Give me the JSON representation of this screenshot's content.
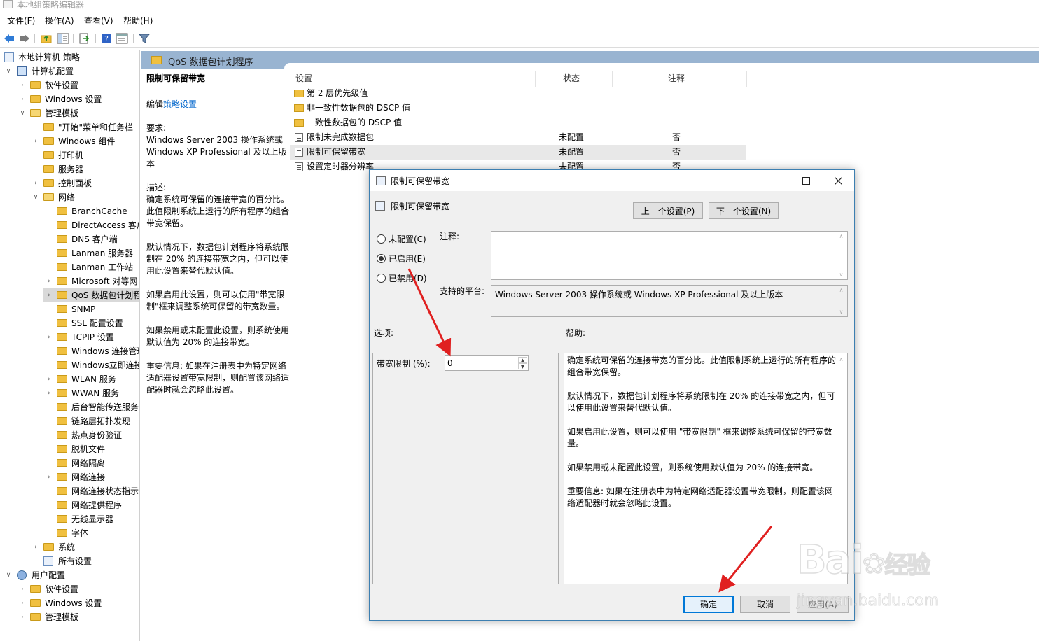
{
  "window": {
    "title": "本地组策略编辑器"
  },
  "menu": [
    "文件(F)",
    "操作(A)",
    "查看(V)",
    "帮助(H)"
  ],
  "toolbar": {
    "icons": [
      "back-arrow-icon",
      "forward-arrow-icon",
      "up-folder-icon",
      "show-hide-tree-icon",
      "export-list-icon",
      "help-icon",
      "properties-icon",
      "filter-icon"
    ]
  },
  "tree": {
    "root": "本地计算机 策略",
    "computer_config": "计算机配置",
    "software_settings": "软件设置",
    "windows_settings": "Windows 设置",
    "admin_templates": "管理模板",
    "start_menu": "\"开始\"菜单和任务栏",
    "windows_components": "Windows 组件",
    "printers": "打印机",
    "server": "服务器",
    "control_panel": "控制面板",
    "network": "网络",
    "network_children": [
      "BranchCache",
      "DirectAccess 客户",
      "DNS 客户端",
      "Lanman 服务器",
      "Lanman 工作站",
      "Microsoft 对等网",
      "QoS 数据包计划程",
      "SNMP",
      "SSL 配置设置",
      "TCPIP 设置",
      "Windows 连接管理",
      "Windows立即连接",
      "WLAN 服务",
      "WWAN 服务",
      "后台智能传送服务",
      "链路层拓扑发现",
      "热点身份验证",
      "脱机文件",
      "网络隔离",
      "网络连接",
      "网络连接状态指示",
      "网络提供程序",
      "无线显示器",
      "字体"
    ],
    "system": "系统",
    "all_settings": "所有设置",
    "user_config": "用户配置",
    "user_software": "软件设置",
    "user_windows": "Windows 设置",
    "user_admin": "管理模板"
  },
  "pane": {
    "header": "QoS 数据包计划程序",
    "desc": {
      "title": "限制可保留带宽",
      "edit_prefix": "编辑",
      "edit_link": "策略设置",
      "req_label": "要求:",
      "req_text": "Windows Server 2003 操作系统或 Windows XP Professional 及以上版本",
      "desc_label": "描述:",
      "p1": "确定系统可保留的连接带宽的百分比。此值限制系统上运行的所有程序的组合带宽保留。",
      "p2": "默认情况下，数据包计划程序将系统限制在 20% 的连接带宽之内，但可以使用此设置来替代默认值。",
      "p3": "如果启用此设置，则可以使用\"带宽限制\"框来调整系统可保留的带宽数量。",
      "p4": "如果禁用或未配置此设置，则系统使用默认值为 20% 的连接带宽。",
      "p5": "重要信息: 如果在注册表中为特定网络适配器设置带宽限制，则配置该网络适配器时就会忽略此设置。"
    },
    "columns": {
      "setting": "设置",
      "state": "状态",
      "comment": "注释"
    },
    "rows": [
      {
        "name": "第 2 层优先级值",
        "state": "",
        "comment": ""
      },
      {
        "name": "非一致性数据包的 DSCP 值",
        "state": "",
        "comment": ""
      },
      {
        "name": "一致性数据包的 DSCP 值",
        "state": "",
        "comment": ""
      },
      {
        "name": "限制未完成数据包",
        "state": "未配置",
        "comment": "否"
      },
      {
        "name": "限制可保留带宽",
        "state": "未配置",
        "comment": "否"
      },
      {
        "name": "设置定时器分辨率",
        "state": "未配置",
        "comment": "否"
      }
    ]
  },
  "dialog": {
    "title": "限制可保留带宽",
    "setting_name": "限制可保留带宽",
    "prev_button": "上一个设置(P)",
    "next_button": "下一个设置(N)",
    "radio_not_configured": "未配置(C)",
    "radio_enabled": "已启用(E)",
    "radio_disabled": "已禁用(D)",
    "comment_label": "注释:",
    "platform_label": "支持的平台:",
    "platform_text": "Windows Server 2003 操作系统或 Windows XP Professional 及以上版本",
    "options_label": "选项:",
    "help_label": "帮助:",
    "bandwidth_label": "带宽限制 (%):",
    "bandwidth_value": "0",
    "help": {
      "p1": "确定系统可保留的连接带宽的百分比。此值限制系统上运行的所有程序的组合带宽保留。",
      "p2": "默认情况下，数据包计划程序将系统限制在 20% 的连接带宽之内，但可以使用此设置来替代默认值。",
      "p3": "如果启用此设置，则可以使用 \"带宽限制\" 框来调整系统可保留的带宽数量。",
      "p4": "如果禁用或未配置此设置，则系统使用默认值为 20% 的连接带宽。",
      "p5": "重要信息: 如果在注册表中为特定网络适配器设置带宽限制，则配置该网络适配器时就会忽略此设置。"
    },
    "ok_button": "确定",
    "cancel_button": "取消",
    "apply_button": "应用(A)",
    "selected_state": "enabled"
  },
  "watermark": {
    "brand": "Bai",
    "brand_cn": "经验",
    "url": "jingyan.baidu.com"
  },
  "colors": {
    "accent": "#0078d7",
    "header": "#99b4d1",
    "arrow": "#e02020",
    "link": "#0066cc"
  }
}
